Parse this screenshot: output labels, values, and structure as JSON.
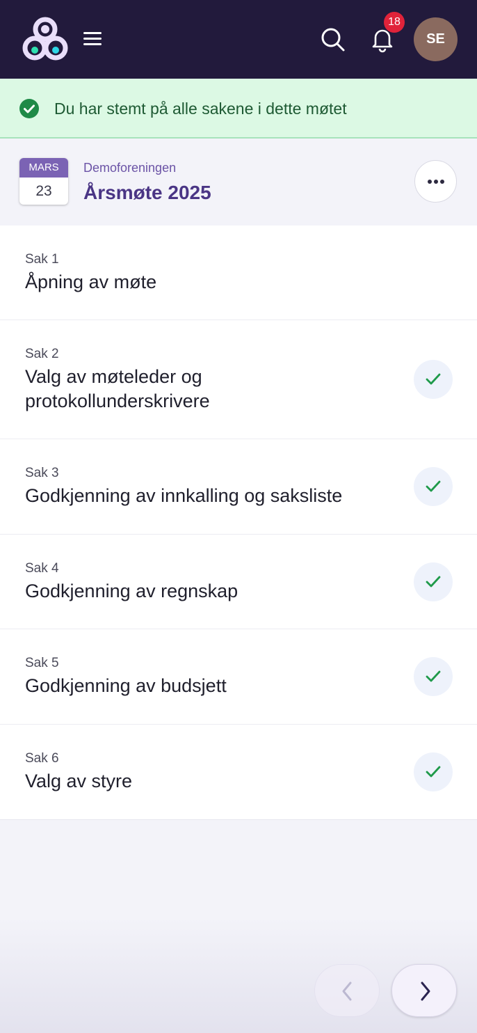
{
  "header": {
    "notifications_count": "18",
    "avatar_initials": "SE"
  },
  "banner": {
    "message": "Du har stemt på alle sakene i dette møtet"
  },
  "meeting": {
    "month": "MARS",
    "day": "23",
    "organization": "Demoforeningen",
    "title": "Årsmøte 2025"
  },
  "items": [
    {
      "number": "Sak 1",
      "title": "Åpning av møte",
      "voted": false
    },
    {
      "number": "Sak 2",
      "title": "Valg av møteleder og protokollunderskrivere",
      "voted": true
    },
    {
      "number": "Sak 3",
      "title": "Godkjenning av innkalling og saksliste",
      "voted": true
    },
    {
      "number": "Sak 4",
      "title": "Godkjenning av regnskap",
      "voted": true
    },
    {
      "number": "Sak 5",
      "title": "Godkjenning av budsjett",
      "voted": true
    },
    {
      "number": "Sak 6",
      "title": "Valg av styre",
      "voted": true
    }
  ],
  "colors": {
    "header_bg": "#221a3c",
    "accent": "#4a3585",
    "success": "#1f9a4a",
    "badge": "#e0233a"
  }
}
